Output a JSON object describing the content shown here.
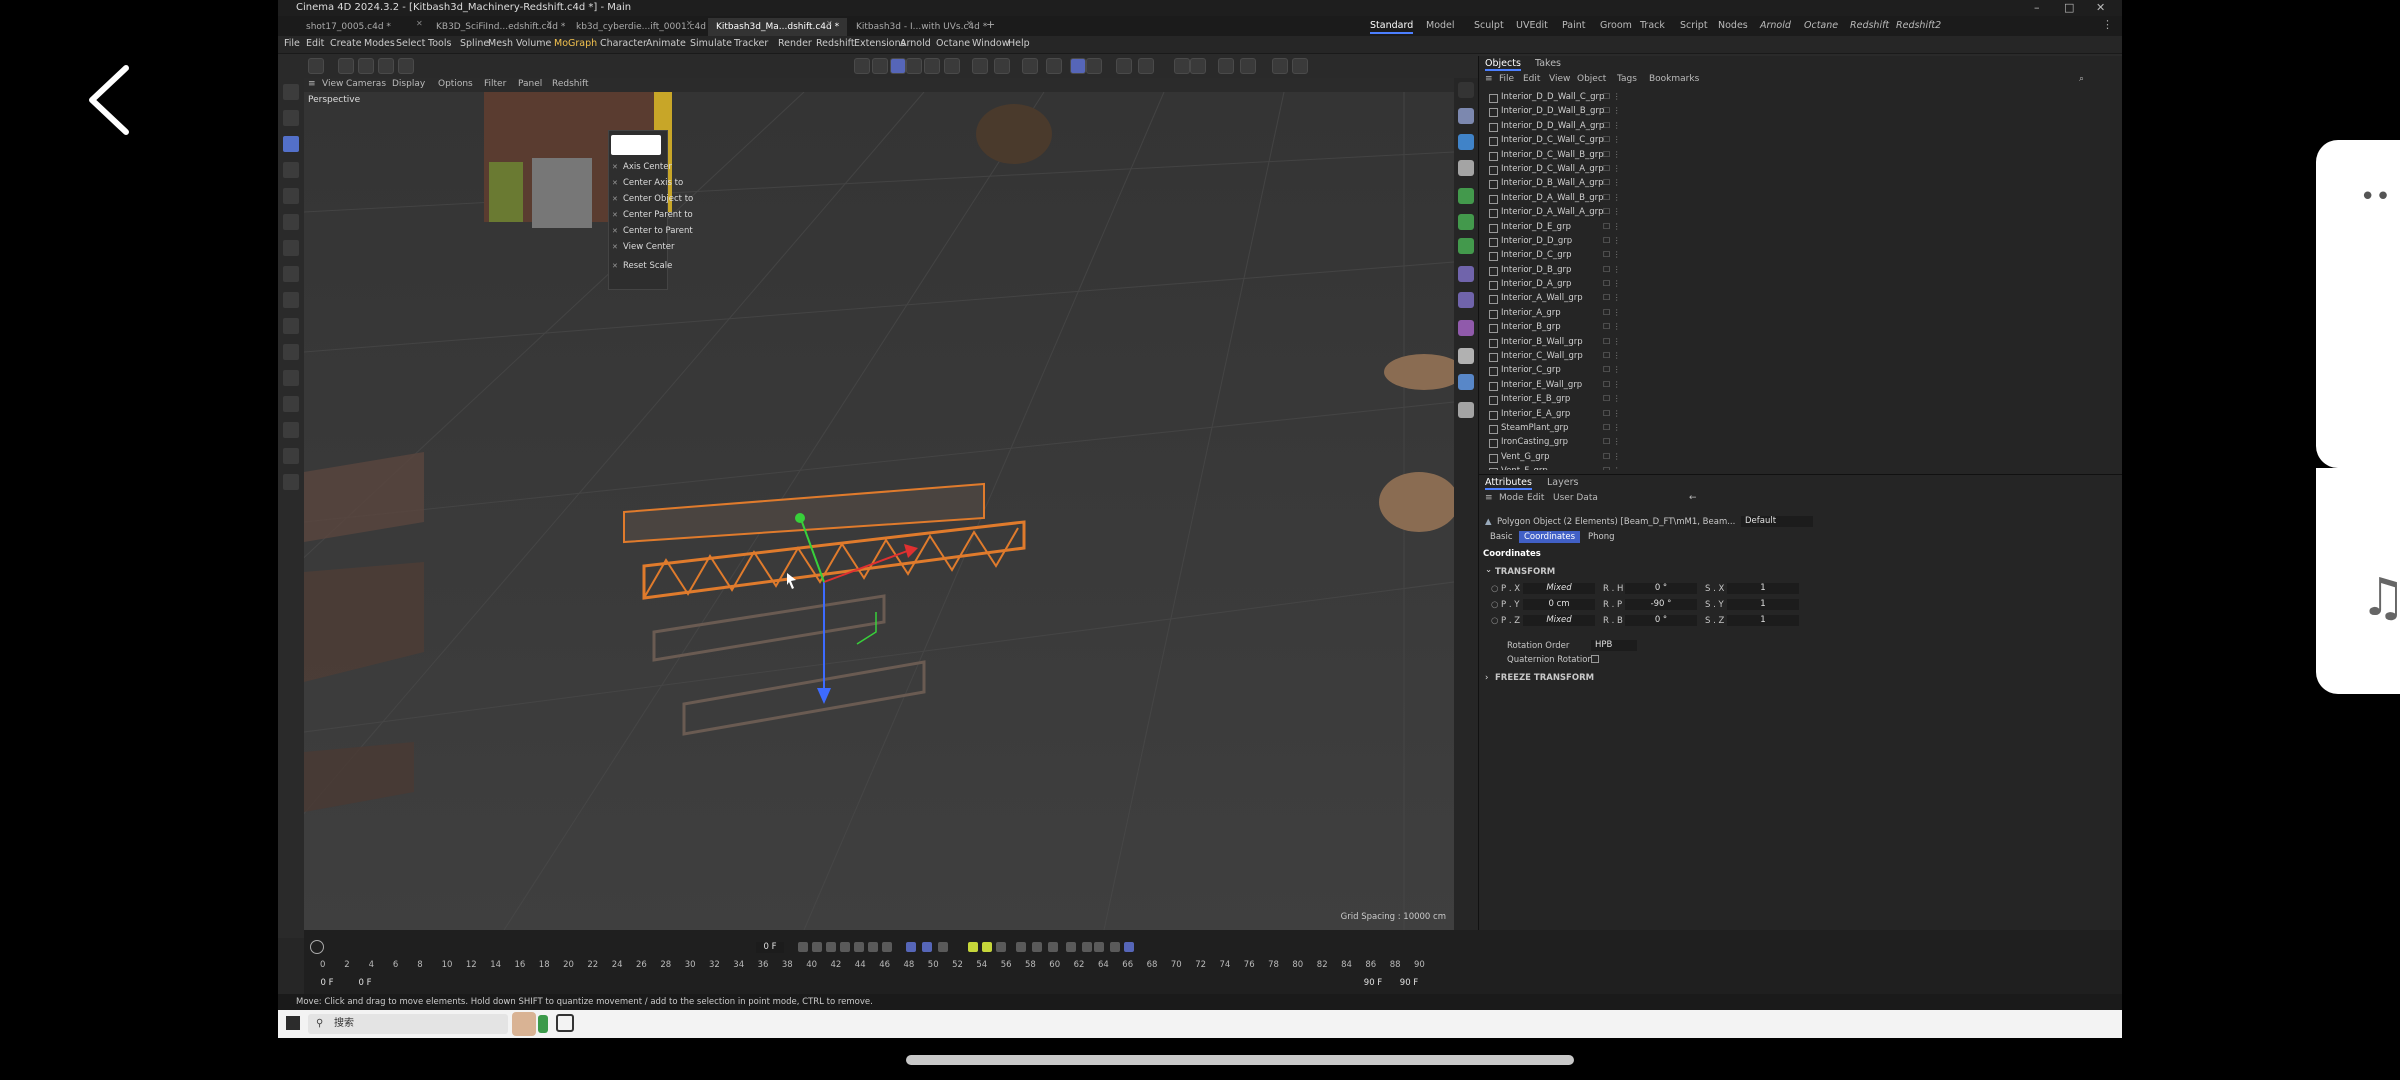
{
  "window": {
    "title": "Cinema 4D 2024.3.2 - [Kitbash3d_Machinery-Redshift.c4d *] - Main",
    "controls": [
      "–",
      "□",
      "✕"
    ]
  },
  "doc_tabs": [
    {
      "label": "shot17_0005.c4d *",
      "active": false
    },
    {
      "label": "KB3D_SciFiInd...edshift.c4d *",
      "active": false
    },
    {
      "label": "kb3d_cyberdie...ift_0001.c4d *",
      "active": false
    },
    {
      "label": "Kitbash3d_Ma...dshift.c4d *",
      "active": true
    },
    {
      "label": "Kitbash3d - I...with UVs.c4d *",
      "active": false
    }
  ],
  "layouts": [
    {
      "label": "Standard",
      "active": true,
      "italic": false
    },
    {
      "label": "Model",
      "active": false,
      "italic": false
    },
    {
      "label": "Sculpt",
      "active": false,
      "italic": false
    },
    {
      "label": "UVEdit",
      "active": false,
      "italic": false
    },
    {
      "label": "Paint",
      "active": false,
      "italic": false
    },
    {
      "label": "Groom",
      "active": false,
      "italic": false
    },
    {
      "label": "Track",
      "active": false,
      "italic": false
    },
    {
      "label": "Script",
      "active": false,
      "italic": false
    },
    {
      "label": "Nodes",
      "active": false,
      "italic": false
    },
    {
      "label": "Arnold",
      "active": false,
      "italic": true
    },
    {
      "label": "Octane",
      "active": false,
      "italic": true
    },
    {
      "label": "Redshift",
      "active": false,
      "italic": true
    },
    {
      "label": "Redshift2",
      "active": false,
      "italic": true
    }
  ],
  "menu": [
    {
      "label": "File",
      "hl": false
    },
    {
      "label": "Edit",
      "hl": false
    },
    {
      "label": "Create",
      "hl": false
    },
    {
      "label": "Modes",
      "hl": false
    },
    {
      "label": "Select",
      "hl": false
    },
    {
      "label": "Tools",
      "hl": false
    },
    {
      "label": "Spline",
      "hl": false
    },
    {
      "label": "Mesh",
      "hl": false
    },
    {
      "label": "Volume",
      "hl": false
    },
    {
      "label": "MoGraph",
      "hl": true
    },
    {
      "label": "Character",
      "hl": false
    },
    {
      "label": "Animate",
      "hl": false
    },
    {
      "label": "Simulate",
      "hl": false
    },
    {
      "label": "Tracker",
      "hl": false
    },
    {
      "label": "Render",
      "hl": false
    },
    {
      "label": "Redshift",
      "hl": false
    },
    {
      "label": "Extensions",
      "hl": false
    },
    {
      "label": "Arnold",
      "hl": false
    },
    {
      "label": "Octane",
      "hl": false
    },
    {
      "label": "Window",
      "hl": false
    },
    {
      "label": "Help",
      "hl": false
    }
  ],
  "viewport_menu": [
    "View",
    "Cameras",
    "Display",
    "Options",
    "Filter",
    "Panel",
    "Redshift"
  ],
  "viewport": {
    "label": "Perspective",
    "grid_spacing": "Grid Spacing : 10000 cm"
  },
  "context_menu": [
    "Axis Center",
    "Center Axis to",
    "Center Object to",
    "Center Parent to",
    "Center to Parent",
    "View Center",
    "Reset Scale"
  ],
  "objects_panel": {
    "tabs": [
      "Objects",
      "Takes"
    ],
    "menu": [
      "File",
      "Edit",
      "View",
      "Object",
      "Tags",
      "Bookmarks"
    ],
    "items": [
      "Interior_D_D_Wall_C_grp",
      "Interior_D_D_Wall_B_grp",
      "Interior_D_D_Wall_A_grp",
      "Interior_D_C_Wall_C_grp",
      "Interior_D_C_Wall_B_grp",
      "Interior_D_C_Wall_A_grp",
      "Interior_D_B_Wall_A_grp",
      "Interior_D_A_Wall_B_grp",
      "Interior_D_A_Wall_A_grp",
      "Interior_D_E_grp",
      "Interior_D_D_grp",
      "Interior_D_C_grp",
      "Interior_D_B_grp",
      "Interior_D_A_grp",
      "Interior_A_Wall_grp",
      "Interior_A_grp",
      "Interior_B_grp",
      "Interior_B_Wall_grp",
      "Interior_C_Wall_grp",
      "Interior_C_grp",
      "Interior_E_Wall_grp",
      "Interior_E_B_grp",
      "Interior_E_A_grp",
      "SteamPlant_grp",
      "IronCasting_grp",
      "Vent_G_grp",
      "Vent_F_grp"
    ]
  },
  "attributes_panel": {
    "tabs": [
      "Attributes",
      "Layers"
    ],
    "menu": [
      "Mode",
      "Edit",
      "User Data"
    ],
    "object_title": "Polygon Object (2 Elements) [Beam_D_FT\\mM1, Beam...",
    "preset": "Default",
    "subtabs": [
      {
        "label": "Basic",
        "active": false
      },
      {
        "label": "Coordinates",
        "active": true
      },
      {
        "label": "Phong",
        "active": false
      }
    ],
    "section": "Coordinates",
    "transform_header": "TRANSFORM",
    "rows": [
      {
        "p_label": "P . X",
        "p_val": "Mixed",
        "r_label": "R . H",
        "r_val": "0 °",
        "s_label": "S . X",
        "s_val": "1"
      },
      {
        "p_label": "P . Y",
        "p_val": "0 cm",
        "r_label": "R . P",
        "r_val": "-90 °",
        "s_label": "S . Y",
        "s_val": "1"
      },
      {
        "p_label": "P . Z",
        "p_val": "Mixed",
        "r_label": "R . B",
        "r_val": "0 °",
        "s_label": "S . Z",
        "s_val": "1"
      }
    ],
    "rotation_order_label": "Rotation Order",
    "rotation_order_value": "HPB",
    "quaternion_label": "Quaternion Rotation",
    "freeze_header": "FREEZE TRANSFORM"
  },
  "timeline": {
    "current_frame": "0 F",
    "ticks": [
      "0",
      "2",
      "4",
      "6",
      "8",
      "10",
      "12",
      "14",
      "16",
      "18",
      "20",
      "22",
      "24",
      "26",
      "28",
      "30",
      "32",
      "34",
      "36",
      "38",
      "40",
      "42",
      "44",
      "46",
      "48",
      "50",
      "52",
      "54",
      "56",
      "58",
      "60",
      "62",
      "64",
      "66",
      "68",
      "70",
      "72",
      "74",
      "76",
      "78",
      "80",
      "82",
      "84",
      "86",
      "88",
      "90"
    ],
    "start_a": "0 F",
    "start_b": "0 F",
    "end_a": "90 F",
    "end_b": "90 F"
  },
  "status": "Move: Click and drag to move elements. Hold down SHIFT to quantize movement / add to the selection in point mode, CTRL to remove.",
  "taskbar": {
    "search_placeholder": "搜索"
  },
  "colors": {
    "accent": "#4c7fff",
    "menu_highlight": "#f2c14e",
    "beam_highlight": "#e07b2c"
  }
}
